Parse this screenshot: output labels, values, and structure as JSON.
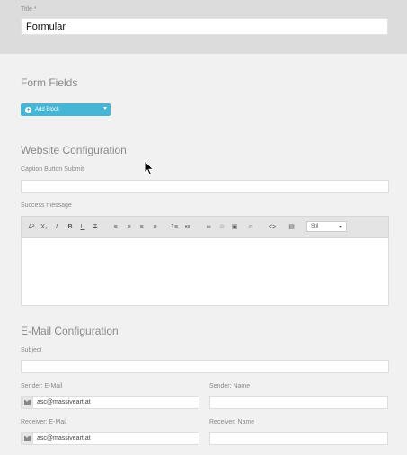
{
  "title_section": {
    "label": "Title *",
    "value": "Formular"
  },
  "form_fields": {
    "heading": "Form Fields",
    "add_block_label": "Add Block"
  },
  "website_config": {
    "heading": "Website Configuration",
    "caption_label": "Caption Button Submit",
    "caption_value": "",
    "success_label": "Success message",
    "style_select_value": "Stil"
  },
  "email_config": {
    "heading": "E-Mail Configuration",
    "subject_label": "Subject",
    "subject_value": "",
    "sender_email_label": "Sender: E-Mail",
    "sender_email_value": "asc@massiveart.at",
    "sender_name_label": "Sender: Name",
    "sender_name_value": "",
    "receiver_email_label": "Receiver: E-Mail",
    "receiver_email_value": "asc@massiveart.at",
    "receiver_name_label": "Receiver: Name",
    "receiver_name_value": ""
  },
  "toolbar_buttons": [
    "A²",
    "X₂",
    "I",
    "B",
    "U",
    "T",
    "≡",
    "≡",
    "≡",
    "≡",
    "1≡",
    "•≡",
    "∞",
    "⊘",
    "▣",
    "☺",
    "<>",
    "▤"
  ]
}
